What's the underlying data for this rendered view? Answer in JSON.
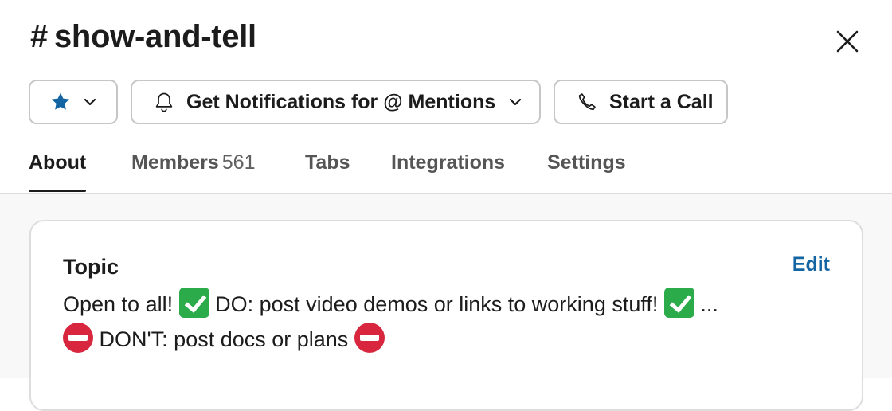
{
  "channel": {
    "hash": "#",
    "name": "show-and-tell"
  },
  "header": {
    "close_icon": "close-icon"
  },
  "actions": {
    "star_icon": "star-icon",
    "star_color": "#1264a3",
    "notifications_label": "Get Notifications for @ Mentions",
    "call_label": "Start a Call"
  },
  "tabs": [
    {
      "label": "About",
      "active": true
    },
    {
      "label": "Members",
      "count": "561"
    },
    {
      "label": "Tabs"
    },
    {
      "label": "Integrations"
    },
    {
      "label": "Settings"
    }
  ],
  "topic": {
    "label": "Topic",
    "edit_label": "Edit",
    "line1_part1": "Open to all!",
    "line1_part2": "DO: post video demos or links to working stuff!",
    "line1_part3": "...",
    "line2_part1": "DON'T: post docs or plans"
  },
  "colors": {
    "accent_link": "#1264a3",
    "check_emoji": "#2bab4a",
    "no_entry_emoji": "#d7263d"
  }
}
